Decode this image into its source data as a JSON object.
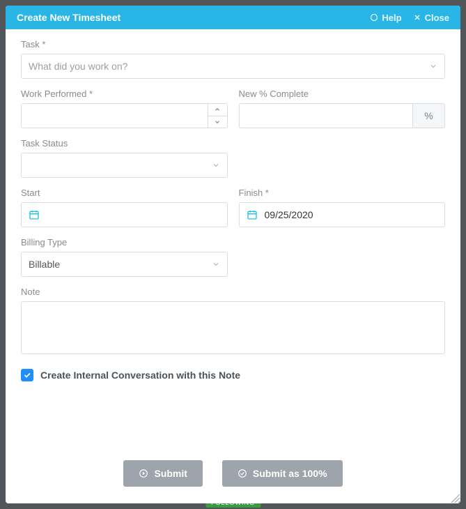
{
  "header": {
    "title": "Create New Timesheet",
    "help_label": "Help",
    "close_label": "Close"
  },
  "fields": {
    "task": {
      "label": "Task *",
      "placeholder": "What did you work on?"
    },
    "work_performed": {
      "label": "Work Performed *",
      "value": ""
    },
    "new_pct_complete": {
      "label": "New % Complete",
      "value": "",
      "addon": "%"
    },
    "task_status": {
      "label": "Task Status",
      "value": ""
    },
    "start": {
      "label": "Start",
      "value": ""
    },
    "finish": {
      "label": "Finish *",
      "value": "09/25/2020"
    },
    "billing_type": {
      "label": "Billing Type",
      "value": "Billable"
    },
    "note": {
      "label": "Note",
      "value": ""
    }
  },
  "checkbox": {
    "label": "Create Internal Conversation with this Note",
    "checked": true
  },
  "buttons": {
    "submit": "Submit",
    "submit_100": "Submit as 100%"
  },
  "background": {
    "following": "FOLLOWING"
  }
}
